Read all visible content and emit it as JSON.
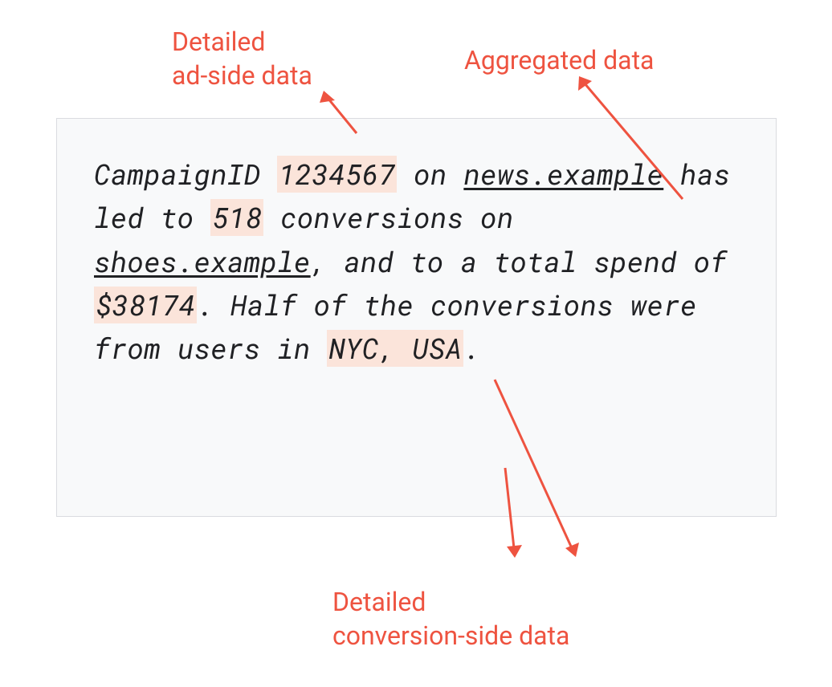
{
  "annotations": {
    "top_left": "Detailed\nad-side data",
    "top_left_line1": "Detailed",
    "top_left_line2": "ad-side data",
    "top_right": "Aggregated data",
    "bottom_line1": "Detailed",
    "bottom_line2": "conversion-side data"
  },
  "report": {
    "t1": "CampaignID ",
    "campaign_id": "1234567",
    "t2": " on ",
    "ad_site": "news.example",
    "t3": " has led to ",
    "conversions": "518",
    "t4": " conversions on ",
    "conv_site": "shoes.example",
    "t5": ", and to a total spend of ",
    "spend": "$38174",
    "t6": ". Half of the conversions were from users in ",
    "location": "NYC, USA",
    "t7": "."
  },
  "colors": {
    "accent": "#ee5340",
    "highlight_bg": "#fbe4da",
    "box_bg": "#f8f9fa",
    "box_border": "#dadce0",
    "text": "#202124"
  }
}
